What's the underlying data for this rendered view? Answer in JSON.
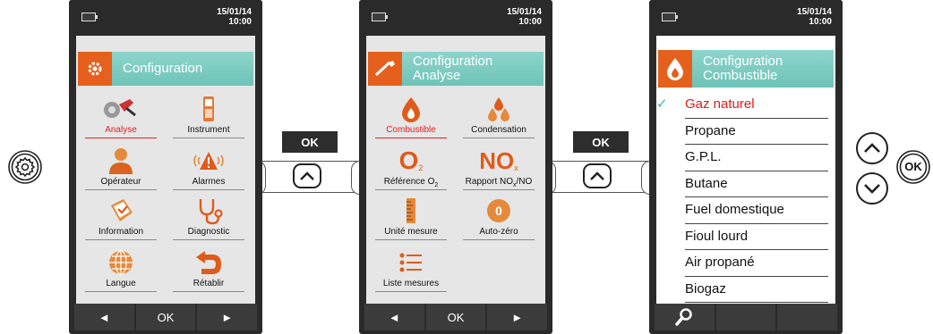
{
  "devices": [
    {
      "date": "15/01/14",
      "time": "10:00",
      "title": "Configuration",
      "tiles": [
        {
          "label": "Analyse",
          "icon": "analyse-icon",
          "selected": true
        },
        {
          "label": "Instrument",
          "icon": "instrument-icon"
        },
        {
          "label": "Opérateur",
          "icon": "operator-icon"
        },
        {
          "label": "Alarmes",
          "icon": "alarm-icon"
        },
        {
          "label": "Information",
          "icon": "information-icon"
        },
        {
          "label": "Diagnostic",
          "icon": "stethoscope-icon"
        },
        {
          "label": "Langue",
          "icon": "globe-icon"
        },
        {
          "label": "Rétablir",
          "icon": "restore-arrow-icon"
        }
      ],
      "softkeys": [
        "◄",
        "OK",
        "►"
      ]
    },
    {
      "date": "15/01/14",
      "time": "10:00",
      "title": "Configuration",
      "subtitle": "Analyse",
      "tiles": [
        {
          "label": "Combustible",
          "icon": "flame-drop-icon",
          "selected": true
        },
        {
          "label": "Condensation",
          "icon": "drops-icon"
        },
        {
          "label": "Référence O",
          "sub": "2",
          "icon": "o2-icon",
          "glyph": "O",
          "glyph_sub": "2"
        },
        {
          "label": "Rapport NO",
          "sub": "x",
          "suffix": "/NO",
          "icon": "nox-icon",
          "glyph": "NO",
          "glyph_sub": "x"
        },
        {
          "label": "Unité mesure",
          "icon": "ruler-icon"
        },
        {
          "label": "Auto-zéro",
          "icon": "auto-zero-icon",
          "glyph": "0"
        },
        {
          "label": "Liste mesures",
          "icon": "list-icon"
        }
      ],
      "softkeys": [
        "◄",
        "OK",
        "►"
      ]
    },
    {
      "date": "15/01/14",
      "time": "10:00",
      "title": "Configuration",
      "subtitle": "Combustible",
      "fuels": [
        "Gaz naturel",
        "Propane",
        "G.P.L.",
        "Butane",
        "Fuel domestique",
        "Fioul lourd",
        "Air propané",
        "Biogaz"
      ],
      "selected_index": 0,
      "check": "✓",
      "softkeys": [
        "search-icon",
        "",
        ""
      ]
    }
  ],
  "connectors": [
    {
      "ok_label": "OK"
    },
    {
      "ok_label": "OK"
    }
  ],
  "keys": {
    "ok_label": "OK"
  },
  "colors": {
    "accent_orange": "#e5601d",
    "title_teal": "#6fc3b8",
    "selected_red": "#e02020",
    "check_teal": "#3bb6a6"
  }
}
